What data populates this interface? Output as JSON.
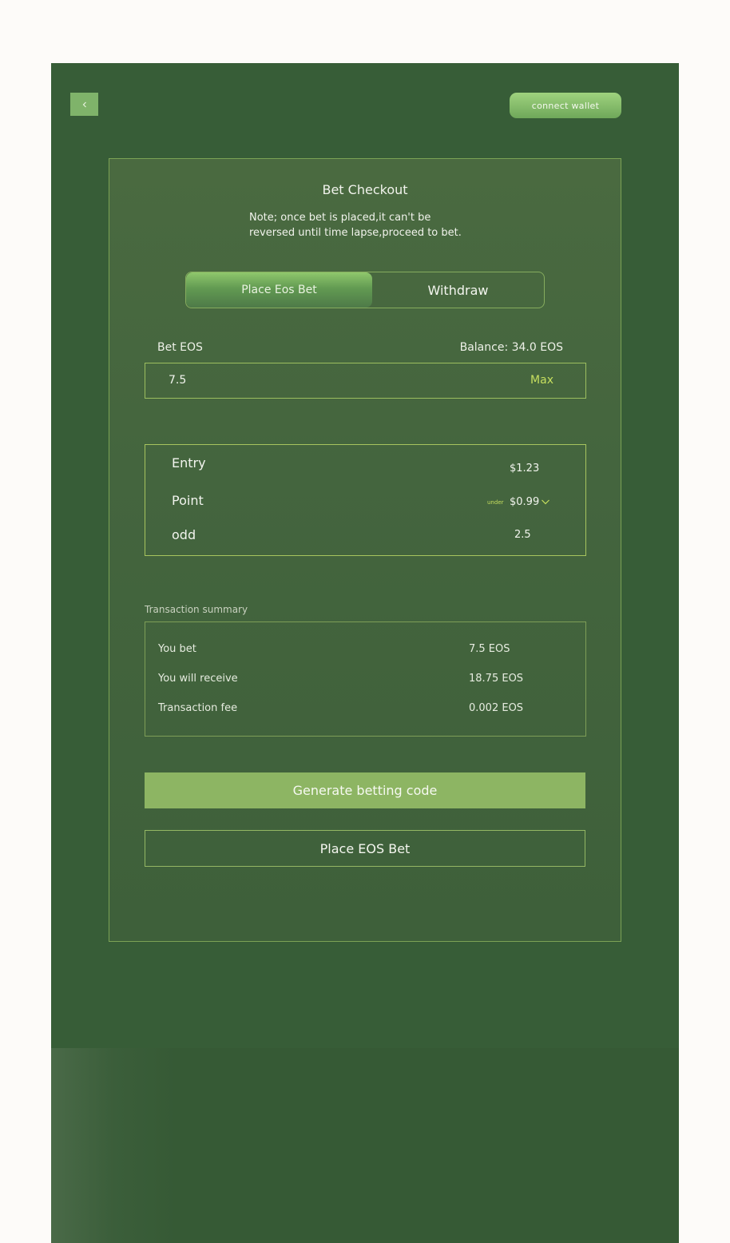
{
  "header": {
    "back_icon": "chevron-left-icon",
    "connect_wallet": "connect wallet"
  },
  "checkout": {
    "title": "Bet Checkout",
    "note_line1": "Note; once bet is placed,it can't be",
    "note_line2": "reversed until time lapse,proceed to bet.",
    "tabs": [
      {
        "label": "Place Eos Bet",
        "active": true
      },
      {
        "label": "Withdraw",
        "active": false
      }
    ],
    "bet_label": "Bet EOS",
    "balance": "Balance: 34.0 EOS",
    "bet_value": "7.5",
    "max_label": "Max"
  },
  "details": {
    "entry_label": "Entry",
    "entry_value": "$1.23",
    "point_label": "Point",
    "point_qualifier": "under",
    "point_value": "$0.99",
    "odd_label": "odd",
    "odd_value": "2.5"
  },
  "summary": {
    "title": "Transaction summary",
    "rows": [
      {
        "label": "You bet",
        "value": "7.5 EOS"
      },
      {
        "label": "You will receive",
        "value": "18.75 EOS"
      },
      {
        "label": "Transaction fee",
        "value": "0.002 EOS"
      }
    ]
  },
  "actions": {
    "generate_code": "Generate betting code",
    "place_bet": "Place EOS Bet"
  },
  "colors": {
    "background": "#375d37",
    "accent": "#8db563",
    "highlight": "#c7df5f"
  }
}
